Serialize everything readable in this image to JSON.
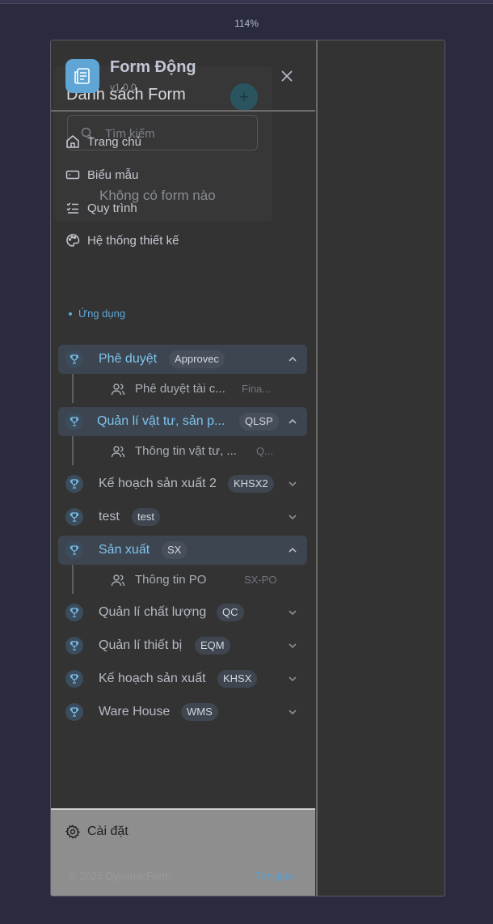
{
  "zoom": "114%",
  "background_form": {
    "title": "Danh sách Form",
    "search_placeholder": "Tìm kiếm",
    "empty_text": "Không có form nào",
    "add_label": "+"
  },
  "header": {
    "app_name": "Form Động",
    "version": "v1.0.0",
    "logo_icon": "document-icon",
    "close_icon": "close-icon"
  },
  "nav": [
    {
      "label": "Trang chủ",
      "icon": "home-icon"
    },
    {
      "label": "Biểu mẫu",
      "icon": "form-icon"
    },
    {
      "label": "Quy trình",
      "icon": "checklist-icon"
    },
    {
      "label": "Hệ thống thiết kế",
      "icon": "palette-icon"
    }
  ],
  "section_label": "Ứng dụng",
  "groups": [
    {
      "label": "Phê duyệt",
      "code": "Approvec",
      "open": true,
      "children": [
        {
          "label": "Phê duyệt tài c...",
          "code": "Fina..."
        }
      ]
    },
    {
      "label": "Quản lí vật tư, sản p...",
      "code": "QLSP",
      "open": true,
      "children": [
        {
          "label": "Thông tin vật tư, ...",
          "code": "Q..."
        }
      ]
    },
    {
      "label": "Kế hoạch sản xuất 2",
      "code": "KHSX2",
      "open": false,
      "children": []
    },
    {
      "label": "test",
      "code": "test",
      "open": false,
      "children": []
    },
    {
      "label": "Sản xuất",
      "code": "SX",
      "open": true,
      "children": [
        {
          "label": "Thông tin PO",
          "code": "SX-PO"
        }
      ]
    },
    {
      "label": "Quản lí chất lượng",
      "code": "QC",
      "open": false,
      "children": []
    },
    {
      "label": "Quản lí thiết bị",
      "code": "EQM",
      "open": false,
      "children": []
    },
    {
      "label": "Kế hoạch sản xuất",
      "code": "KHSX",
      "open": false,
      "children": []
    },
    {
      "label": "Ware House",
      "code": "WMS",
      "open": false,
      "children": []
    }
  ],
  "footer": {
    "settings_label": "Cài đặt",
    "settings_icon": "gear-icon",
    "copyright": "© 2025 DynamicForm",
    "help_label": "Trợ giúp"
  },
  "colors": {
    "accent": "#5fa9d9",
    "sidebar_bg": "#333333",
    "page_bg": "#2b2b40",
    "footer_bg": "#8e8e8e"
  }
}
